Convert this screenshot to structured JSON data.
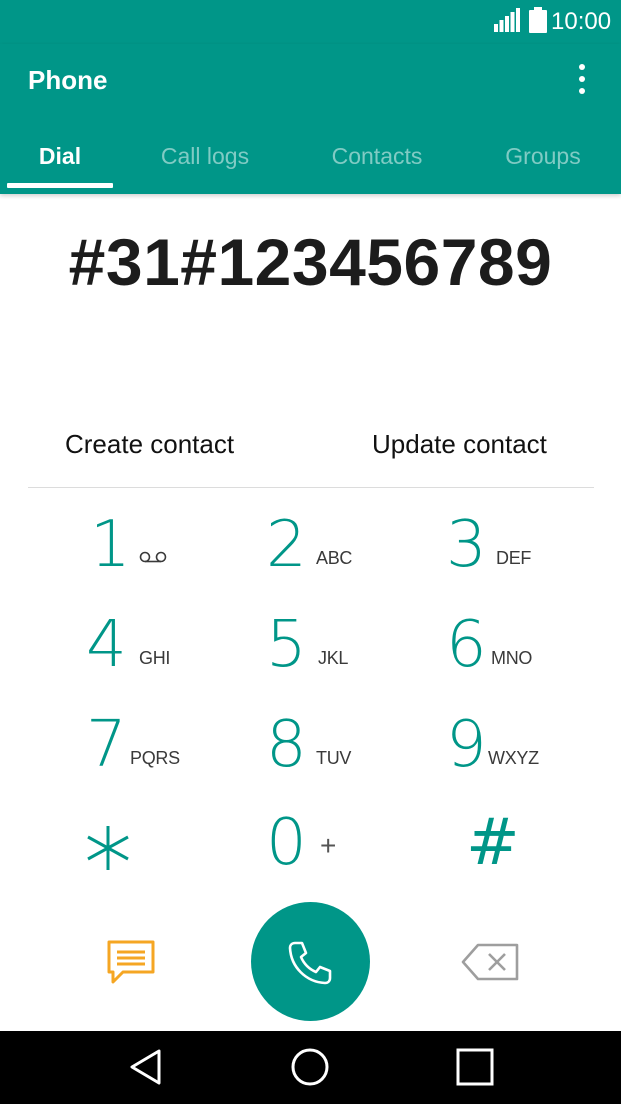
{
  "status_bar": {
    "time": "10:00"
  },
  "app_bar": {
    "title": "Phone"
  },
  "tabs": [
    {
      "label": "Dial"
    },
    {
      "label": "Call logs"
    },
    {
      "label": "Contacts"
    },
    {
      "label": "Groups"
    }
  ],
  "dialer": {
    "number": "#31#123456789",
    "create_contact": "Create contact",
    "update_contact": "Update contact"
  },
  "keypad": [
    {
      "digit": "1",
      "letters": ""
    },
    {
      "digit": "2",
      "letters": "ABC"
    },
    {
      "digit": "3",
      "letters": "DEF"
    },
    {
      "digit": "4",
      "letters": "GHI"
    },
    {
      "digit": "5",
      "letters": "JKL"
    },
    {
      "digit": "6",
      "letters": "MNO"
    },
    {
      "digit": "7",
      "letters": "PQRS"
    },
    {
      "digit": "8",
      "letters": "TUV"
    },
    {
      "digit": "9",
      "letters": "WXYZ"
    },
    {
      "digit": "*",
      "letters": ""
    },
    {
      "digit": "0",
      "letters": "+"
    },
    {
      "digit": "#",
      "letters": ""
    }
  ],
  "colors": {
    "accent": "#009688",
    "message_icon": "#f5a623",
    "backspace_icon": "#9e9e9e"
  },
  "icons": {
    "signal": "signal-icon",
    "battery": "battery-icon",
    "overflow": "overflow-menu-icon",
    "voicemail": "voicemail-icon",
    "message": "message-icon",
    "call": "phone-icon",
    "backspace": "backspace-icon",
    "nav_back": "back-icon",
    "nav_home": "home-icon",
    "nav_recents": "recents-icon"
  }
}
